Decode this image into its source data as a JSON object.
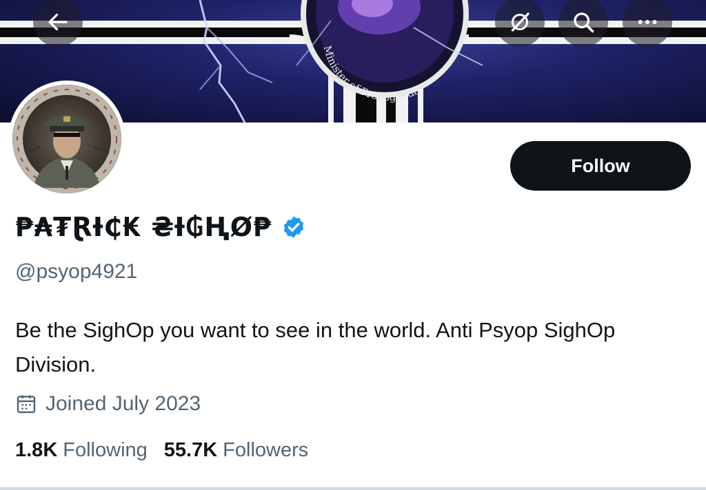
{
  "banner": {
    "emblem_text": "Minister of Propaganda"
  },
  "nav": {
    "back_icon": "arrow-left-icon",
    "pin_icon": "no-pin-icon",
    "search_icon": "search-icon",
    "more_icon": "more-dots-icon"
  },
  "avatar": {
    "ring_text": "SIGHOPS SIGHOPS SIGHOPS"
  },
  "profile": {
    "follow_label": "Follow",
    "display_name": "₱₳₮ⱤƗ₵₭ ₴Ɨ₲ⱧØ₱",
    "handle": "@psyop4921",
    "bio": "Be the SighOp you want to see in the world. Anti Psyop SighOp Division.",
    "joined": "Joined July 2023",
    "following_count": "1.8K",
    "following_label": "Following",
    "followers_count": "55.7K",
    "followers_label": "Followers"
  },
  "colors": {
    "primary_text": "#0f1419",
    "secondary_text": "#536471",
    "verified_blue": "#1d9bf0",
    "button_bg": "#0f1419"
  }
}
